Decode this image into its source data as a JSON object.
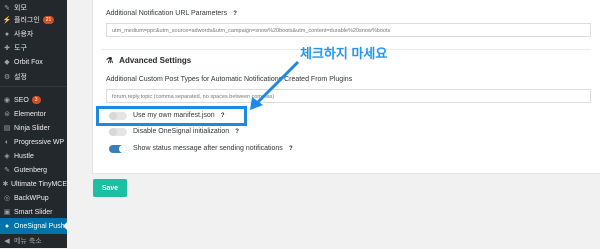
{
  "sidebar": {
    "items": [
      {
        "label": "외모",
        "icon": "brush-icon"
      },
      {
        "label": "플러그인",
        "icon": "plug-icon",
        "badge": "21"
      },
      {
        "label": "사용자",
        "icon": "user-icon"
      },
      {
        "label": "도구",
        "icon": "wrench-icon"
      },
      {
        "label": "Orbit Fox",
        "icon": "fox-icon"
      },
      {
        "label": "설정",
        "icon": "settings-icon"
      },
      {
        "label": "SEO",
        "icon": "seo-icon",
        "badge": "3"
      },
      {
        "label": "Elementor",
        "icon": "elementor-icon"
      },
      {
        "label": "Ninja Slider",
        "icon": "slider-icon"
      },
      {
        "label": "Progressive WP",
        "icon": "progressive-icon"
      },
      {
        "label": "Hustle",
        "icon": "hustle-icon"
      },
      {
        "label": "Gutenberg",
        "icon": "gutenberg-icon"
      },
      {
        "label": "Ultimate TinyMCE",
        "icon": "tinymce-icon"
      },
      {
        "label": "BackWPup",
        "icon": "backup-icon"
      },
      {
        "label": "Smart Slider",
        "icon": "smart-slider-icon"
      },
      {
        "label": "OneSignal Push",
        "icon": "onesignal-icon",
        "current": true
      },
      {
        "label": "메뉴 축소",
        "icon": "collapse-icon"
      }
    ]
  },
  "settings": {
    "notification_url": {
      "label": "Additional Notification URL Parameters",
      "value": "utm_medium=ppc&utm_source=adwords&utm_campaign=snow%20boots&utm_content=durable%20snow%boots"
    },
    "advanced_title": "Advanced Settings",
    "custom_post_types": {
      "label": "Additional Custom Post Types for Automatic Notifications Created From Plugins",
      "placeholder": "forum,reply,topic  (comma separated, no spaces between commas)"
    },
    "toggles": [
      {
        "label": "Use my own manifest.json",
        "on": false,
        "hint": "?"
      },
      {
        "label": "Disable OneSignal initialization",
        "on": false,
        "hint": "?"
      },
      {
        "label": "Show status message after sending notifications",
        "on": true,
        "hint": "?"
      }
    ],
    "save_label": "Save"
  },
  "annotation": {
    "text": "체크하지 마세요",
    "color": "#1e88e5"
  },
  "colors": {
    "sidebar_bg": "#23282d",
    "current": "#0073aa",
    "save": "#1cbfa2",
    "highlight": "#1e88e5"
  }
}
